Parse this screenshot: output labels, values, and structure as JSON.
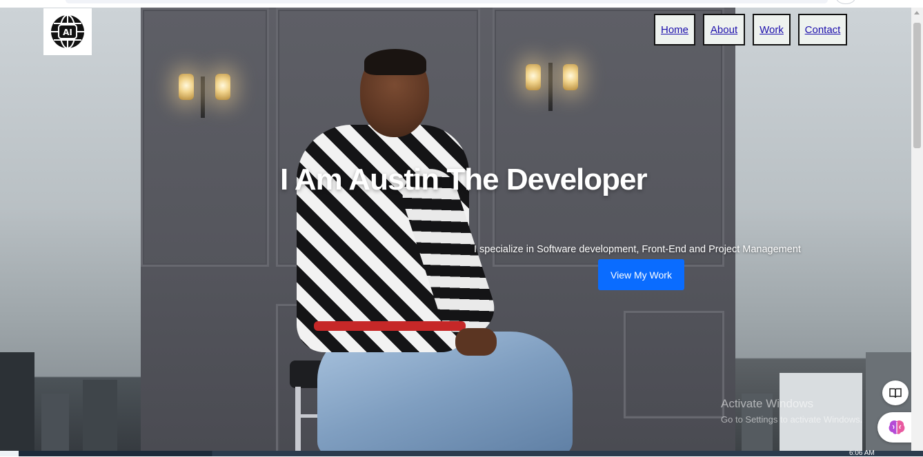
{
  "logo": {
    "icon": "ai-globe-icon",
    "text": "AI"
  },
  "nav": {
    "items": [
      {
        "label": "Home"
      },
      {
        "label": "About"
      },
      {
        "label": "Work"
      },
      {
        "label": "Contact"
      }
    ]
  },
  "hero": {
    "title": "I Am Austin The Developer",
    "subtitle": "I specialize in Software development, Front-End and Project Management",
    "cta_label": "View My Work"
  },
  "watermark": {
    "line1": "Activate Windows",
    "line2": "Go to Settings to activate Windows."
  },
  "floating_buttons": {
    "reader": "reader-mode-icon",
    "assistant": "brain-icon"
  },
  "taskbar": {
    "time": "6:06 AM"
  },
  "colors": {
    "cta": "#0a6cff",
    "nav_bg": "#eef2ef",
    "nav_link": "#1a0dab"
  }
}
